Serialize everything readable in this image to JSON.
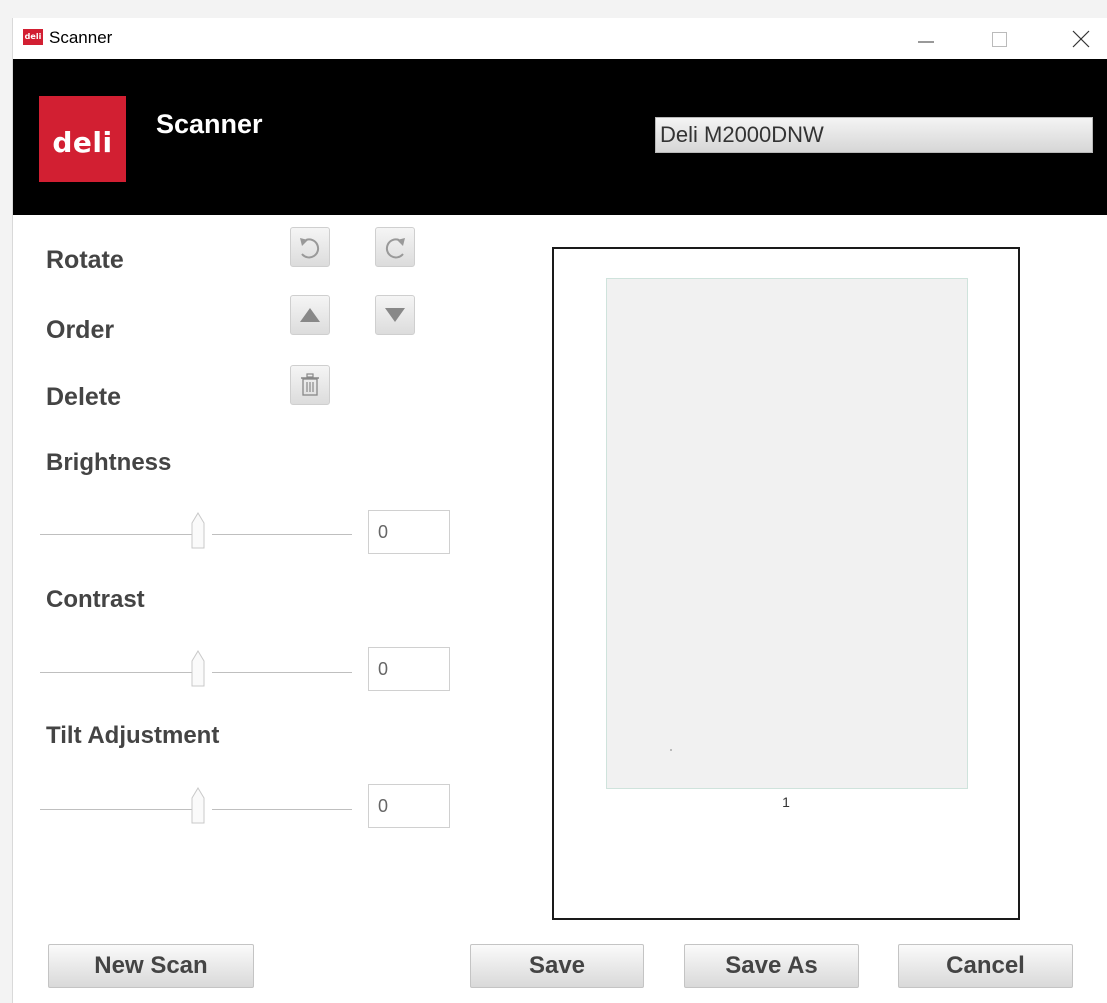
{
  "window": {
    "title": "Scanner",
    "app_icon_text": "deli"
  },
  "header": {
    "logo_text": "deli",
    "title": "Scanner",
    "device": "Deli M2000DNW"
  },
  "controls": {
    "rotate_label": "Rotate",
    "order_label": "Order",
    "delete_label": "Delete",
    "brightness_label": "Brightness",
    "brightness_value": "0",
    "contrast_label": "Contrast",
    "contrast_value": "0",
    "tilt_label": "Tilt Adjustment",
    "tilt_value": "0"
  },
  "preview": {
    "page_number": "1"
  },
  "buttons": {
    "new_scan": "New Scan",
    "save": "Save",
    "save_as": "Save As",
    "cancel": "Cancel"
  },
  "colors": {
    "brand": "#d21f32",
    "header_bg": "#000000"
  },
  "icons": [
    "rotate-left-icon",
    "rotate-right-icon",
    "move-up-icon",
    "move-down-icon",
    "trash-icon",
    "minimize-icon",
    "maximize-icon",
    "close-icon"
  ]
}
